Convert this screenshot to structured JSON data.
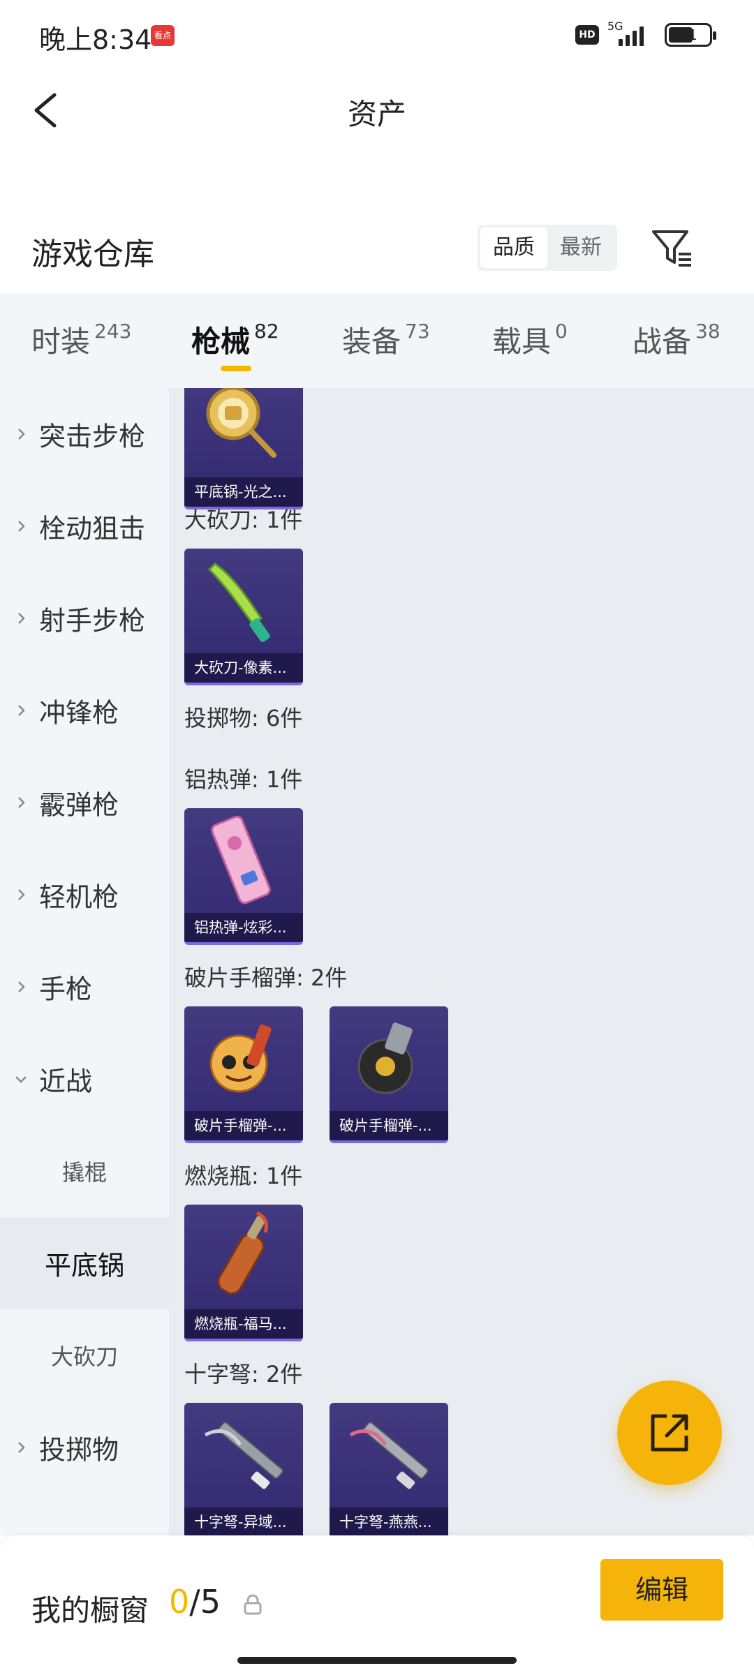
{
  "status_bar": {
    "time": "晚上8:34",
    "app_badge": "看点",
    "hd": "HD",
    "network": "5G",
    "battery": "61",
    "battery_level": 0.61
  },
  "header": {
    "title": "资产"
  },
  "section": {
    "title": "游戏仓库",
    "sort_quality": "品质",
    "sort_newest": "最新"
  },
  "tabs": [
    {
      "label": "时装",
      "count": "243"
    },
    {
      "label": "枪械",
      "count": "82",
      "active": true
    },
    {
      "label": "装备",
      "count": "73"
    },
    {
      "label": "载具",
      "count": "0"
    },
    {
      "label": "战备",
      "count": "38"
    }
  ],
  "sidebar": [
    {
      "label": "突击步枪"
    },
    {
      "label": "栓动狙击"
    },
    {
      "label": "射手步枪"
    },
    {
      "label": "冲锋枪"
    },
    {
      "label": "霰弹枪"
    },
    {
      "label": "轻机枪"
    },
    {
      "label": "手枪"
    },
    {
      "label": "近战",
      "expanded": true
    },
    {
      "label": "撬棍"
    },
    {
      "label": "平底锅",
      "selected": true
    },
    {
      "label": "大砍刀"
    },
    {
      "label": "投掷物"
    }
  ],
  "content": {
    "groups": [
      "大砍刀: 1件",
      "投掷物: 6件",
      "铝热弹: 1件",
      "破片手榴弹: 2件",
      "燃烧瓶: 1件",
      "十字弩: 2件"
    ],
    "items": [
      {
        "name": "平底锅-光之...",
        "icon": "frying-pan-icon"
      },
      {
        "name": "大砍刀-像素...",
        "icon": "machete-icon"
      },
      {
        "name": "铝热弹-炫彩...",
        "icon": "thermite-grenade-icon"
      },
      {
        "name": "破片手榴弹-...",
        "icon": "frag-grenade-icon"
      },
      {
        "name": "破片手榴弹-...",
        "icon": "frag-grenade-icon"
      },
      {
        "name": "燃烧瓶-福马...",
        "icon": "molotov-icon"
      },
      {
        "name": "十字弩-异域...",
        "icon": "crossbow-icon"
      },
      {
        "name": "十字弩-燕燕...",
        "icon": "crossbow-icon"
      }
    ]
  },
  "bottom": {
    "label": "我的橱窗",
    "current": "0",
    "sep_total": "/5",
    "edit": "编辑"
  },
  "colors": {
    "accent": "#f6b40a",
    "card": "#3a3078",
    "tab_bg": "#f3f6f9"
  }
}
